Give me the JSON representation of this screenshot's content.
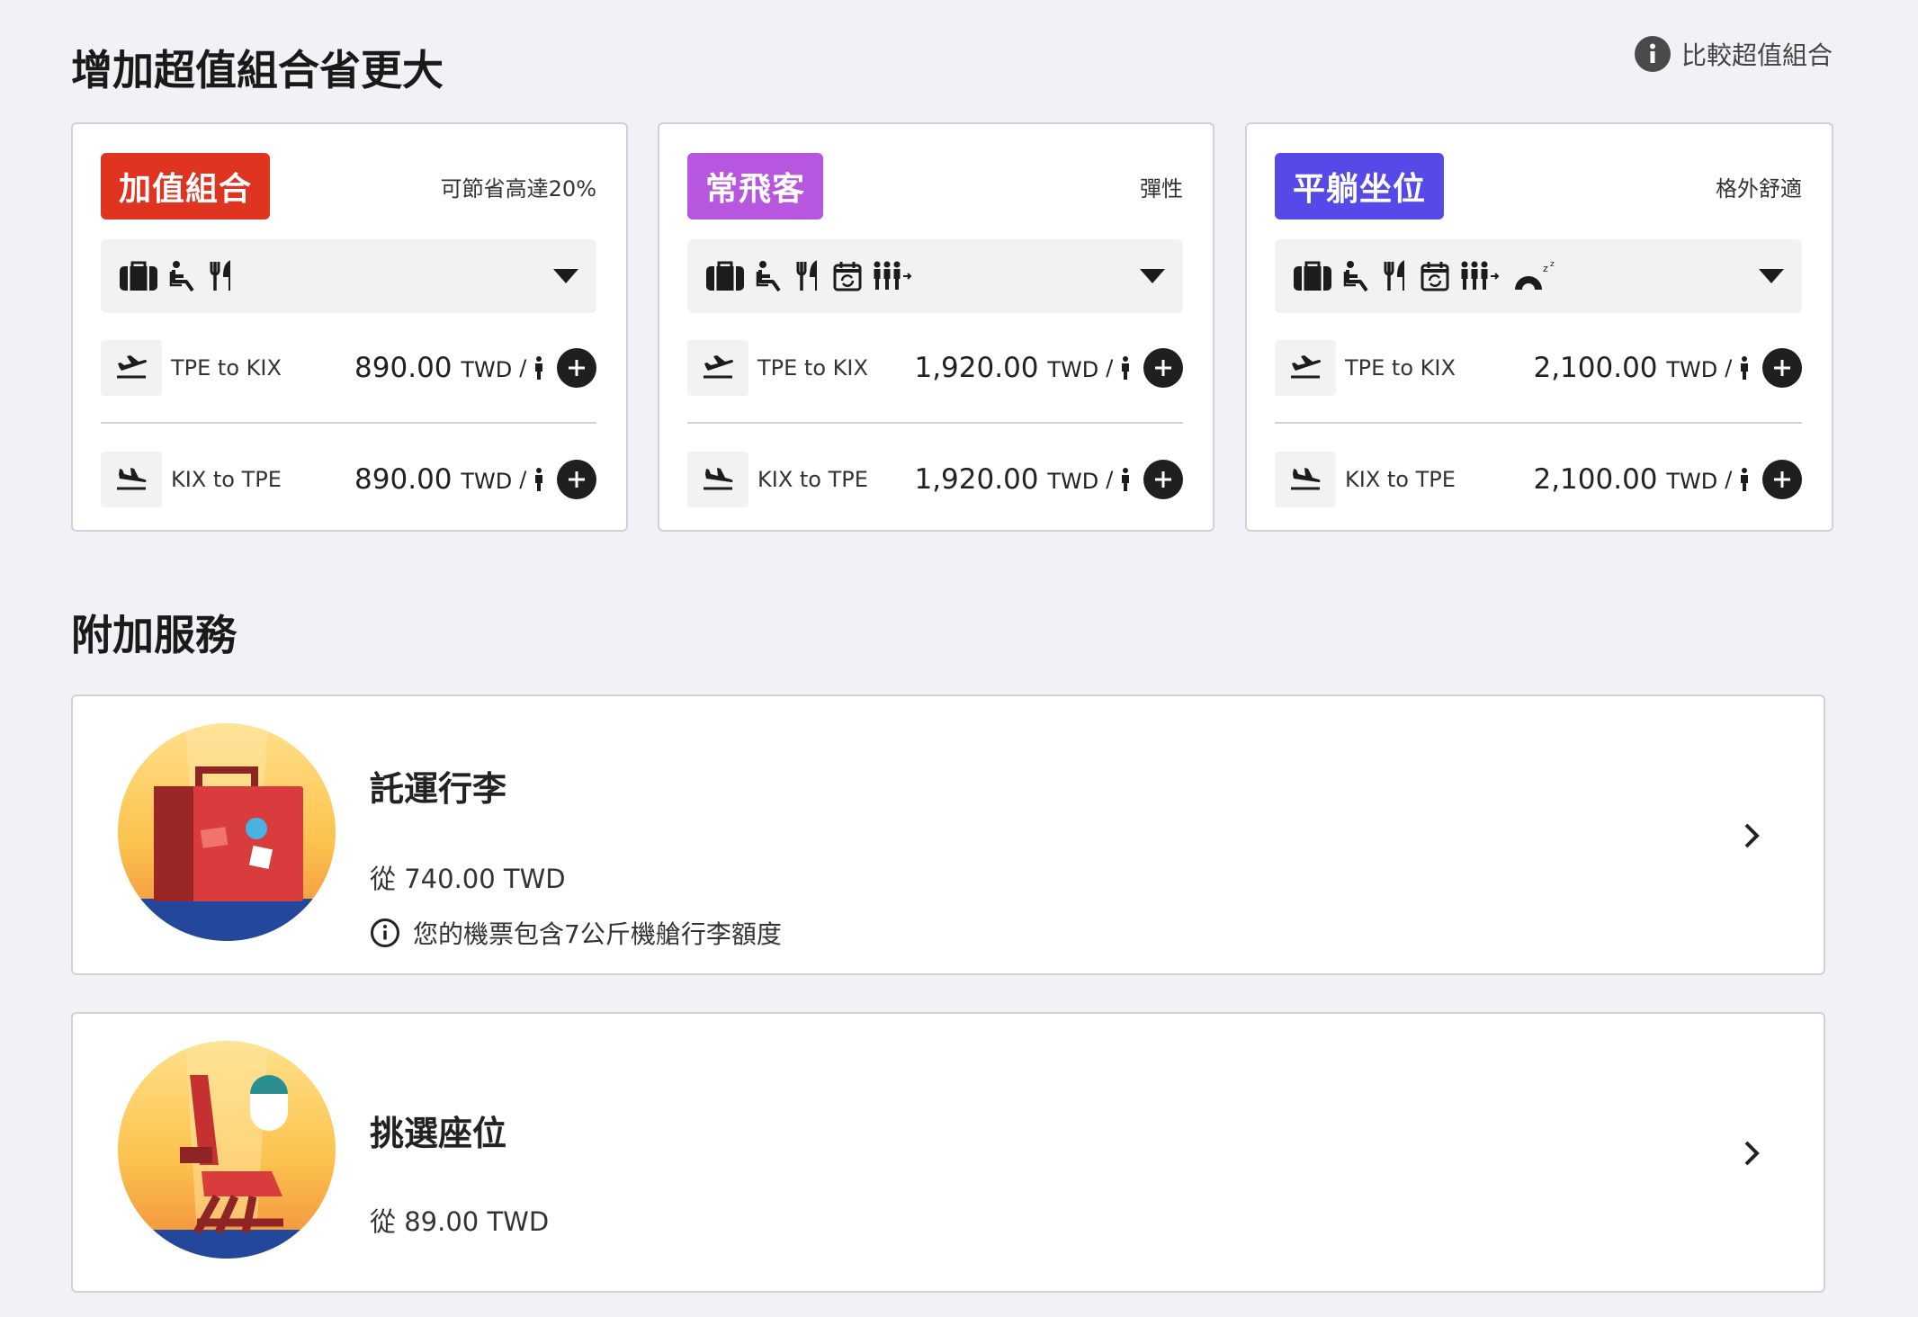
{
  "header": {
    "bundles_title": "增加超值組合省更大",
    "compare_link": "比較超值組合",
    "addons_title": "附加服務"
  },
  "bundles": [
    {
      "badge": "加值組合",
      "badge_color": "#df3420",
      "tagline": "可節省高達20%",
      "icons": [
        "baggage-icon",
        "seat-icon",
        "meal-icon"
      ],
      "routes": [
        {
          "label": "TPE to KIX",
          "price": "890.00",
          "currency": "TWD",
          "per": "/"
        },
        {
          "label": "KIX to TPE",
          "price": "890.00",
          "currency": "TWD",
          "per": "/"
        }
      ]
    },
    {
      "badge": "常飛客",
      "badge_color": "#b757e0",
      "tagline": "彈性",
      "icons": [
        "baggage-icon",
        "seat-icon",
        "meal-icon",
        "flex-date-icon",
        "priority-queue-icon"
      ],
      "routes": [
        {
          "label": "TPE to KIX",
          "price": "1,920.00",
          "currency": "TWD",
          "per": "/"
        },
        {
          "label": "KIX to TPE",
          "price": "1,920.00",
          "currency": "TWD",
          "per": "/"
        }
      ]
    },
    {
      "badge": "平躺坐位",
      "badge_color": "#5549e8",
      "tagline": "格外舒適",
      "icons": [
        "baggage-icon",
        "seat-icon",
        "meal-icon",
        "flex-date-icon",
        "priority-queue-icon",
        "neck-pillow-icon"
      ],
      "routes": [
        {
          "label": "TPE to KIX",
          "price": "2,100.00",
          "currency": "TWD",
          "per": "/"
        },
        {
          "label": "KIX to TPE",
          "price": "2,100.00",
          "currency": "TWD",
          "per": "/"
        }
      ]
    }
  ],
  "services": [
    {
      "name": "託運行李",
      "price": "從 740.00 TWD",
      "note": "您的機票包含7公斤機艙行李額度",
      "icon": "suitcase-illustration"
    },
    {
      "name": "挑選座位",
      "price": "從 89.00 TWD",
      "icon": "seat-illustration"
    }
  ]
}
